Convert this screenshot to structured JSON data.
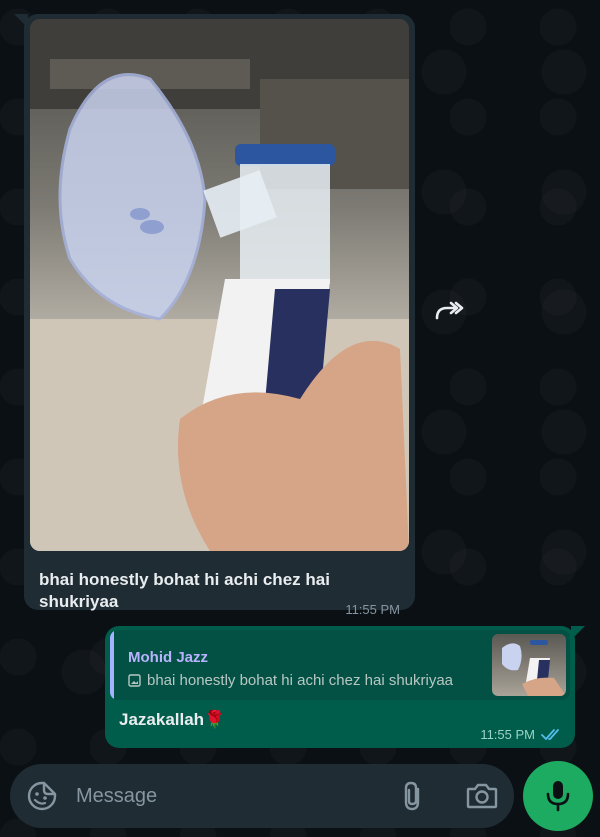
{
  "incoming_message": {
    "caption": "bhai honestly bohat hi achi chez hai shukriyaa",
    "time": "11:55 PM",
    "image_icon": "nebulizer-photo"
  },
  "forward_icon": "forward-icon",
  "outgoing_message": {
    "quote_author": "Mohid Jazz",
    "quote_text": "bhai honestly bohat hi achi chez hai shukriyaa",
    "quote_icon": "image-icon",
    "text": "Jazakallah🌹",
    "time": "11:55 PM",
    "status_icon": "double-check-icon",
    "status_color": "#53bdeb"
  },
  "composer": {
    "placeholder": "Message",
    "emoji_icon": "sticker-icon",
    "attach_icon": "paperclip-icon",
    "camera_icon": "camera-icon",
    "mic_icon": "microphone-icon"
  },
  "colors": {
    "background": "#0b1014",
    "incoming_bubble": "#1f2c34",
    "outgoing_bubble": "#005c4b",
    "accent_green": "#1daa61"
  }
}
